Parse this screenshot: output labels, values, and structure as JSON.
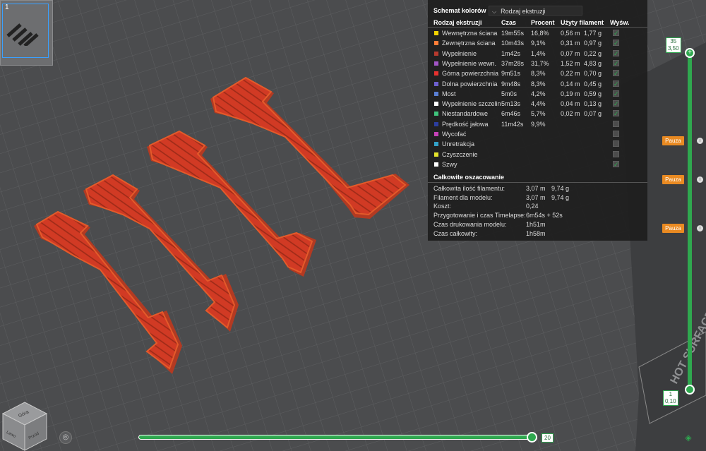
{
  "plate": {
    "number": "1"
  },
  "legend": {
    "scheme_label": "Schemat kolorów",
    "scheme_value": "Rodzaj ekstruzji",
    "columns": {
      "type": "Rodzaj ekstruzji",
      "time": "Czas",
      "percent": "Procent",
      "used": "Użyty filament",
      "show": "Wyśw."
    },
    "rows": [
      {
        "color": "#f2d300",
        "name": "Wewnętrzna ściana",
        "time": "19m55s",
        "percent": "16,8%",
        "m": "0,56 m",
        "g": "1,77 g",
        "show": true
      },
      {
        "color": "#ff7d38",
        "name": "Zewnętrzna ściana",
        "time": "10m43s",
        "percent": "9,1%",
        "m": "0,31 m",
        "g": "0,97 g",
        "show": true
      },
      {
        "color": "#b83a2e",
        "name": "Wypełnienie",
        "time": "1m42s",
        "percent": "1,4%",
        "m": "0,07 m",
        "g": "0,22 g",
        "show": true
      },
      {
        "color": "#a255c6",
        "name": "Wypełnienie wewn.",
        "time": "37m28s",
        "percent": "31,7%",
        "m": "1,52 m",
        "g": "4,83 g",
        "show": true
      },
      {
        "color": "#e8312f",
        "name": "Górna powierzchnia",
        "time": "9m51s",
        "percent": "8,3%",
        "m": "0,22 m",
        "g": "0,70 g",
        "show": true
      },
      {
        "color": "#6e60cf",
        "name": "Dolna powierzchnia",
        "time": "9m48s",
        "percent": "8,3%",
        "m": "0,14 m",
        "g": "0,45 g",
        "show": true
      },
      {
        "color": "#5a7fd4",
        "name": "Most",
        "time": "5m0s",
        "percent": "4,2%",
        "m": "0,19 m",
        "g": "0,59 g",
        "show": true
      },
      {
        "color": "#ffffff",
        "name": "Wypełnienie szczelin",
        "time": "5m13s",
        "percent": "4,4%",
        "m": "0,04 m",
        "g": "0,13 g",
        "show": true
      },
      {
        "color": "#3fc47c",
        "name": "Niestandardowe",
        "time": "6m46s",
        "percent": "5,7%",
        "m": "0,02 m",
        "g": "0,07 g",
        "show": true
      },
      {
        "color": "#2c3ea0",
        "name": "Prędkość jałowa",
        "time": "11m42s",
        "percent": "9,9%",
        "m": "",
        "g": "",
        "show": false
      },
      {
        "color": "#c742b8",
        "name": "Wycofać",
        "time": "",
        "percent": "",
        "m": "",
        "g": "",
        "show": false
      },
      {
        "color": "#33a2c9",
        "name": "Unretrakcja",
        "time": "",
        "percent": "",
        "m": "",
        "g": "",
        "show": false
      },
      {
        "color": "#e4e42c",
        "name": "Czyszczenie",
        "time": "",
        "percent": "",
        "m": "",
        "g": "",
        "show": false
      },
      {
        "color": "#ffffff",
        "name": "Szwy",
        "time": "",
        "percent": "",
        "m": "",
        "g": "",
        "show": true
      }
    ],
    "summary_title": "Całkowite oszacowanie",
    "summary": [
      {
        "k": "Całkowita ilość filamentu:",
        "v1": "3,07 m",
        "v2": "9,74 g"
      },
      {
        "k": "Filament dla modelu:",
        "v1": "3,07 m",
        "v2": "9,74 g"
      },
      {
        "k": "Koszt:",
        "v1": "0,24",
        "v2": ""
      },
      {
        "k": "Przygotowanie i czas Timelapse:",
        "v1": "6m54s + 52s",
        "v2": ""
      },
      {
        "k": "Czas drukowania modelu:",
        "v1": "1h51m",
        "v2": ""
      },
      {
        "k": "Czas całkowity:",
        "v1": "1h58m",
        "v2": ""
      }
    ]
  },
  "layer_slider": {
    "top_layer": "35",
    "top_height": "3,50",
    "bottom_layer": "1",
    "bottom_height": "0,10",
    "pause_label": "Pauza"
  },
  "move_slider": {
    "value": "20",
    "fraction": 1.0
  },
  "viewcube": {
    "top": "Góra",
    "left": "Lewo",
    "front": "Przód"
  },
  "plate_text": "HOT SURFACE"
}
